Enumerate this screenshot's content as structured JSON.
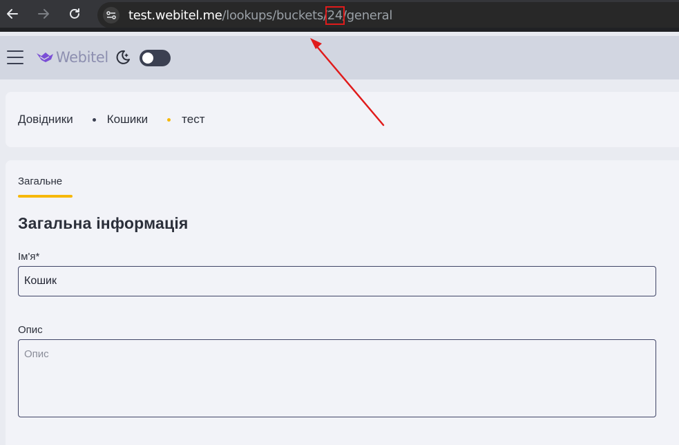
{
  "browser": {
    "url_host": "test.webitel.me",
    "url_path_before": "/lookups/buckets/",
    "url_highlight": "24",
    "url_path_after": "/general"
  },
  "header": {
    "logo_text": "Webitel",
    "theme_toggle_on": false
  },
  "breadcrumb": {
    "items": [
      "Довідники",
      "Кошики",
      "тест"
    ],
    "dot_colors": [
      "#3a3f51",
      "#f6b80b"
    ]
  },
  "tabs": [
    {
      "label": "Загальне",
      "active": true
    }
  ],
  "form": {
    "section_title": "Загальна інформація",
    "name_label": "Ім'я*",
    "name_value": "Кошик",
    "description_label": "Опис",
    "description_placeholder": "Опис"
  },
  "colors": {
    "accent": "#f6b80b",
    "annotation": "#e01b1b"
  }
}
